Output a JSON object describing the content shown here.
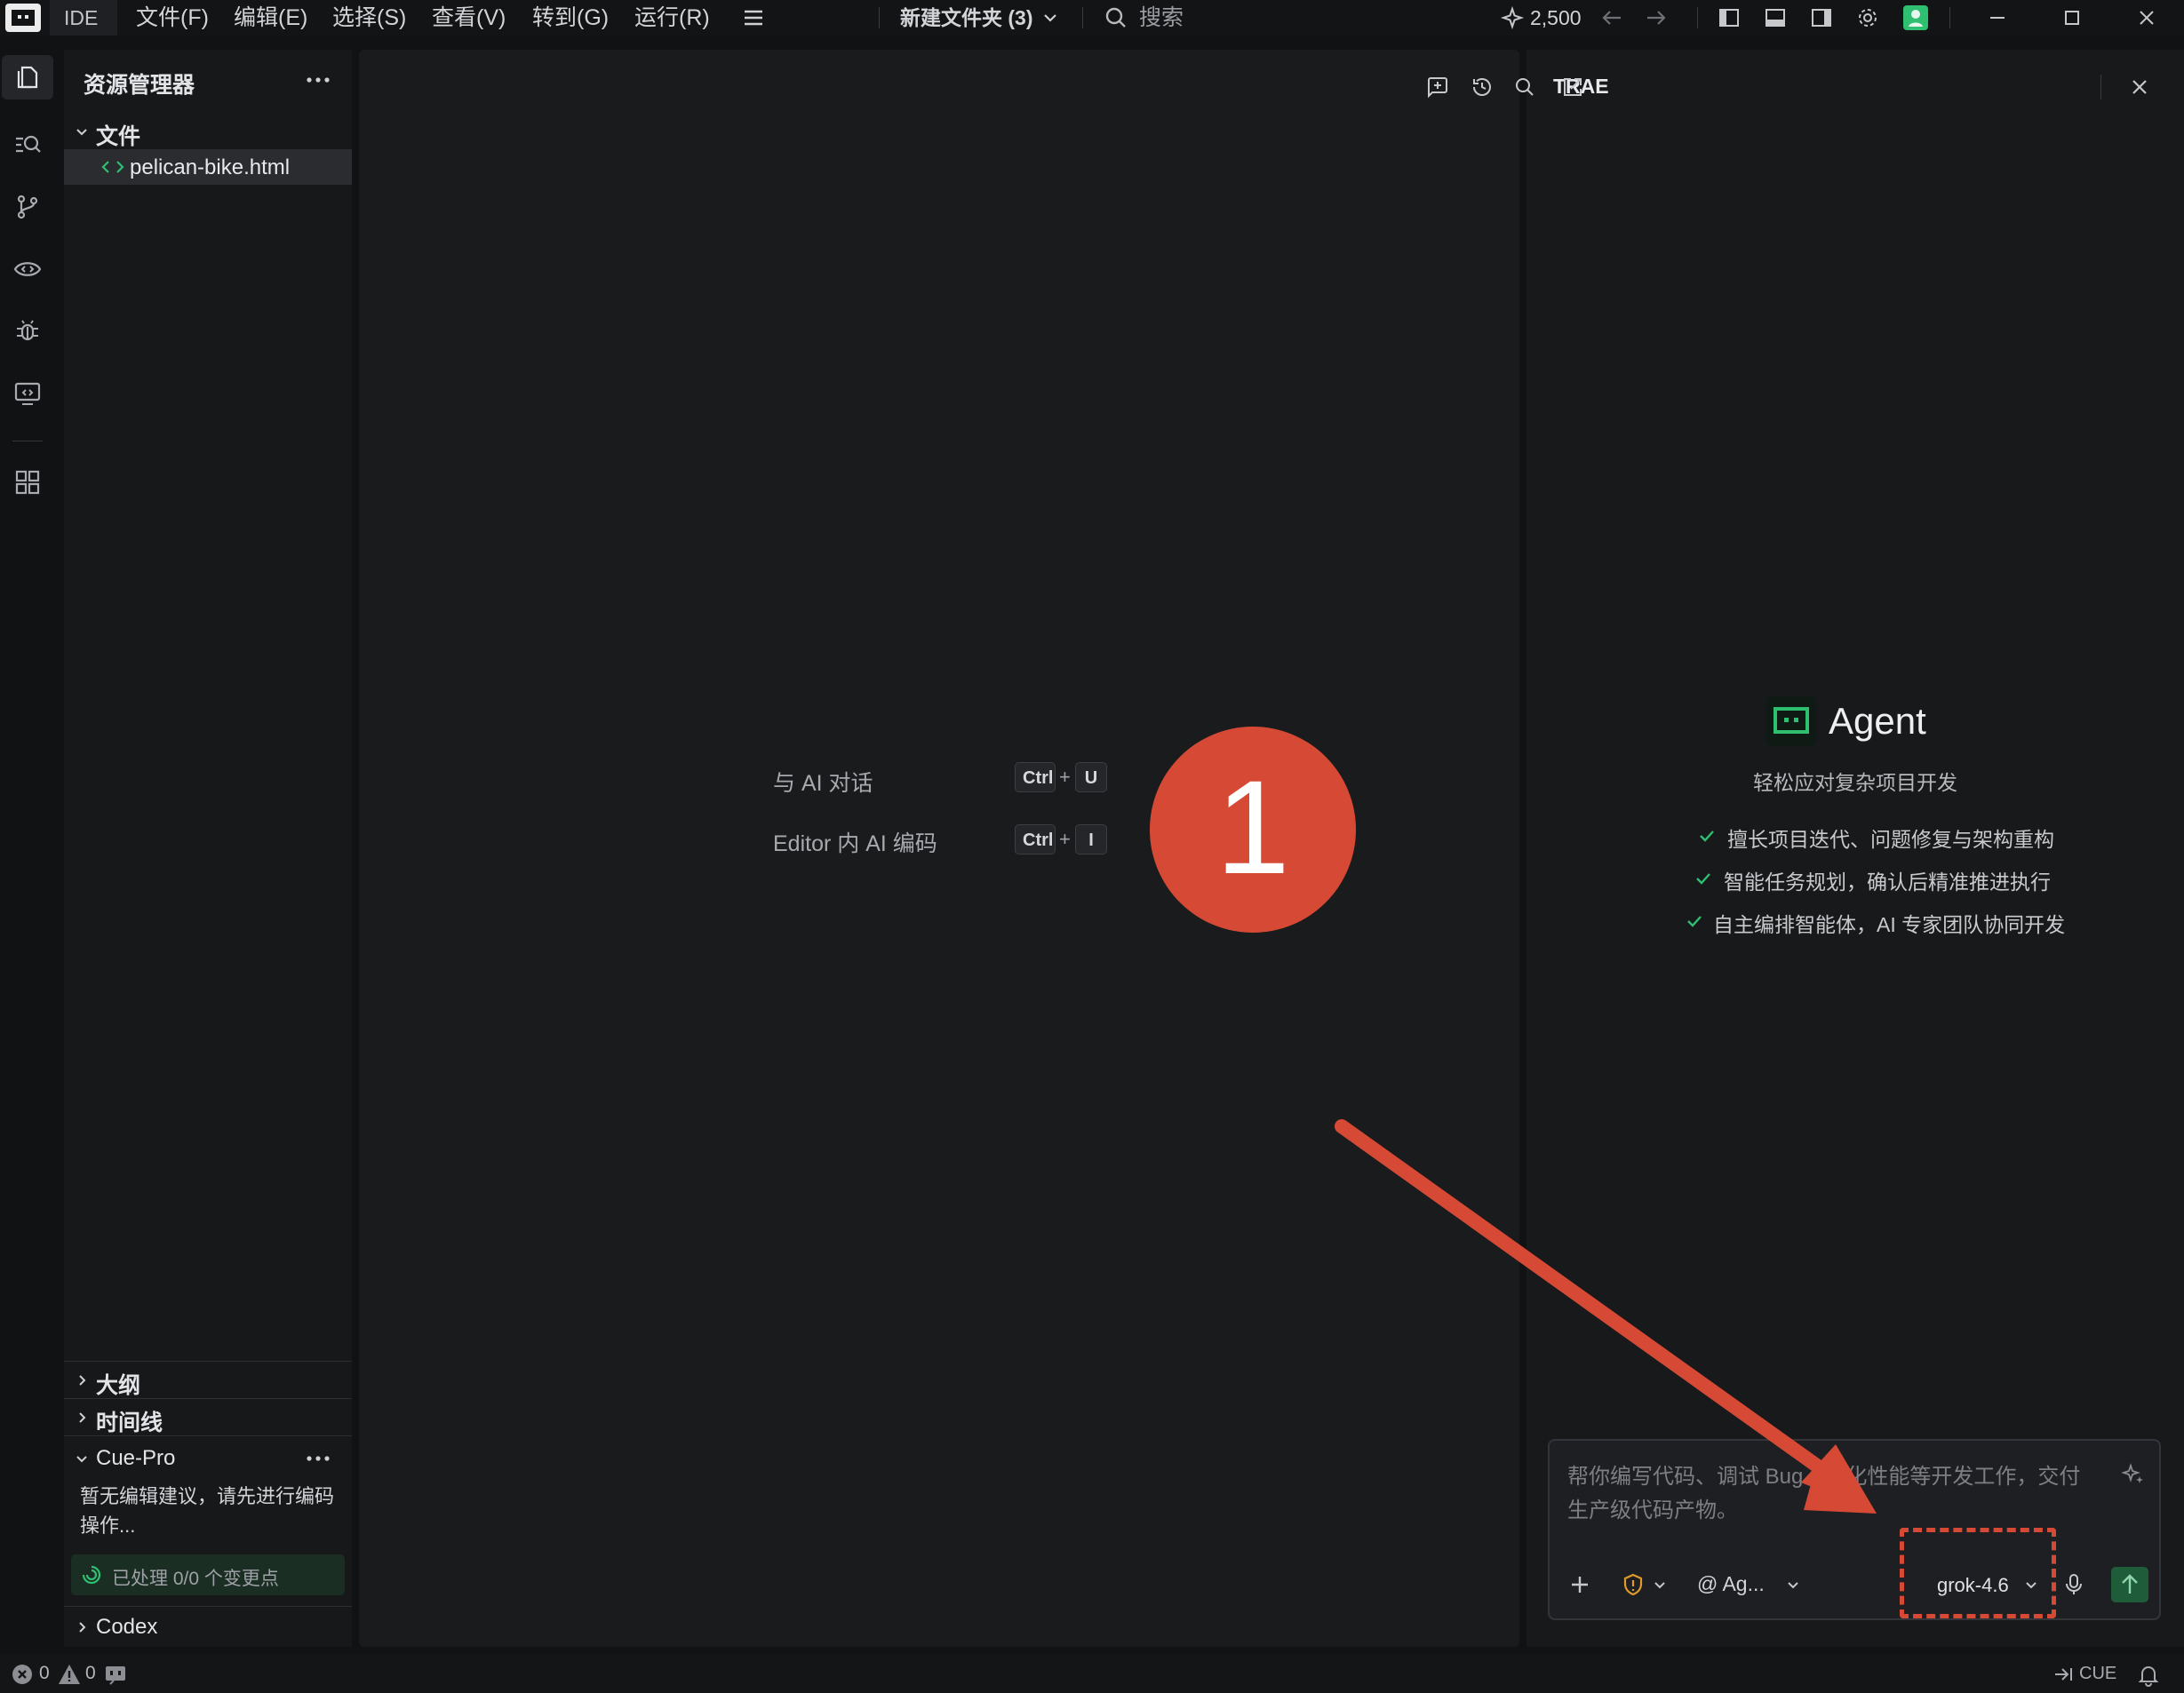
{
  "titlebar": {
    "mode": "IDE",
    "menus": [
      "文件(F)",
      "编辑(E)",
      "选择(S)",
      "查看(V)",
      "转到(G)",
      "运行(R)"
    ],
    "workspace": "新建文件夹 (3)",
    "search_placeholder": "搜索",
    "credits": "2,500"
  },
  "sidebar": {
    "title": "资源管理器",
    "section_files": "文件",
    "file_name": "pelican-bike.html",
    "section_outline": "大纲",
    "section_timeline": "时间线",
    "cue_title": "Cue-Pro",
    "cue_message": "暂无编辑建议，请先进行编码操作...",
    "cue_status": "已处理 0/0 个变更点",
    "codex_title": "Codex"
  },
  "editor": {
    "hint1_label": "与 AI 对话",
    "hint1_key1": "Ctrl",
    "hint1_plus": "+",
    "hint1_key2": "U",
    "hint2_label": "Editor 内 AI 编码",
    "hint2_key1": "Ctrl",
    "hint2_plus": "+",
    "hint2_key2": "I"
  },
  "annotation": {
    "step_number": "1",
    "color": "#d64a35"
  },
  "panel": {
    "title": "TRAE",
    "agent_title": "Agent",
    "agent_subtitle": "轻松应对复杂项目开发",
    "features": [
      "擅长项目迭代、问题修复与架构重构",
      "智能任务规划，确认后精准推进执行",
      "自主编排智能体，AI 专家团队协同开发"
    ],
    "input_placeholder": "帮你编写代码、调试 Bug、优化性能等开发工作，交付生产级代码产物。",
    "agent_selector": "@ Ag...",
    "model": "grok-4.6"
  },
  "statusbar": {
    "errors": "0",
    "warnings": "0",
    "cue_label": "CUE"
  },
  "colors": {
    "accent_green": "#2fbf71",
    "text": "#d6d7da",
    "muted": "#8b8d92"
  }
}
